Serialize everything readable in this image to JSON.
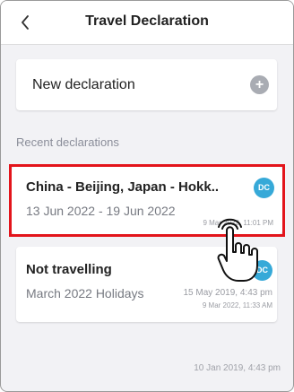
{
  "header": {
    "title": "Travel Declaration",
    "back_icon": "chevron-left-icon"
  },
  "new_declaration": {
    "label": "New declaration",
    "icon": "plus-icon"
  },
  "recent": {
    "section_label": "Recent declarations",
    "items": [
      {
        "title": "China - Beijing, Japan - Hokk..",
        "subtitle": "13 Jun 2022 - 19 Jun 2022",
        "avatar": "DC",
        "time": "9 Mar 2022, 11:01 PM"
      },
      {
        "title": "Not travelling",
        "subtitle": "March 2022 Holidays",
        "avatar": "DC",
        "time_primary": "15 May 2019, 4:43 pm",
        "time_secondary": "9 Mar 2022, 11:33 AM"
      }
    ],
    "footer_time": "10 Jan 2019, 4:43 pm"
  },
  "colors": {
    "highlight": "#e3141b",
    "avatar": "#36a9d8",
    "background": "#f2f2f5"
  }
}
